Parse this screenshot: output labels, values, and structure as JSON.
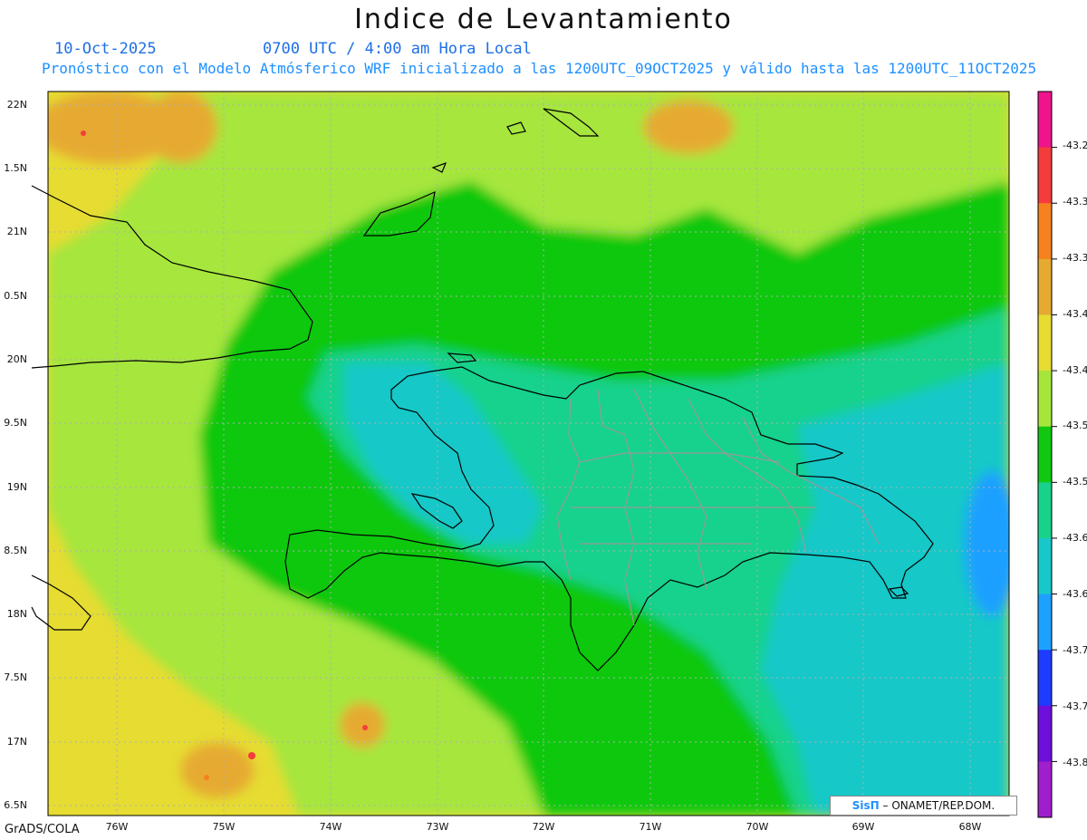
{
  "title": "Indice de Levantamiento",
  "date_label": "10-Oct-2025",
  "time_label": "0700 UTC / 4:00 am Hora Local",
  "forecast_note": "Pronóstico con el Modelo Atmósferico WRF inicializado a las 1200UTC_09OCT2025 y válido hasta las  1200UTC_11OCT2025",
  "footer": "GrADS/COLA",
  "credit": {
    "logo": "SisΠ",
    "text": " – ONAMET/REP.DOM."
  },
  "axes": {
    "y_labels": [
      "22N",
      "1.5N",
      "21N",
      "0.5N",
      "20N",
      "9.5N",
      "19N",
      "8.5N",
      "18N",
      "7.5N",
      "17N",
      "6.5N"
    ],
    "x_labels": [
      "76W",
      "75W",
      "74W",
      "73W",
      "72W",
      "71W",
      "70W",
      "69W",
      "68W"
    ]
  },
  "colorbar": {
    "labels": [
      "-43.2",
      "-43.3",
      "-43.3",
      "-43.4",
      "-43.4",
      "-43.5",
      "-43.5",
      "-43.6",
      "-43.6",
      "-43.7",
      "-43.7",
      "-43.8"
    ],
    "colors": [
      "#f0148c",
      "#f53c3c",
      "#f5821e",
      "#e6aa32",
      "#e6dc32",
      "#a6e63c",
      "#10c810",
      "#18d28c",
      "#18c8c8",
      "#1ea0ff",
      "#1e3cff",
      "#6e0fdc",
      "#a01ecc"
    ]
  },
  "field_colors": {
    "base_yellow": "#e6dc32",
    "light_green": "#a6e63c",
    "green": "#10c810",
    "teal": "#18d28c",
    "cyan": "#18c8c8",
    "blue": "#1ea0ff",
    "orange": "#e6aa32",
    "red": "#f53c3c"
  }
}
